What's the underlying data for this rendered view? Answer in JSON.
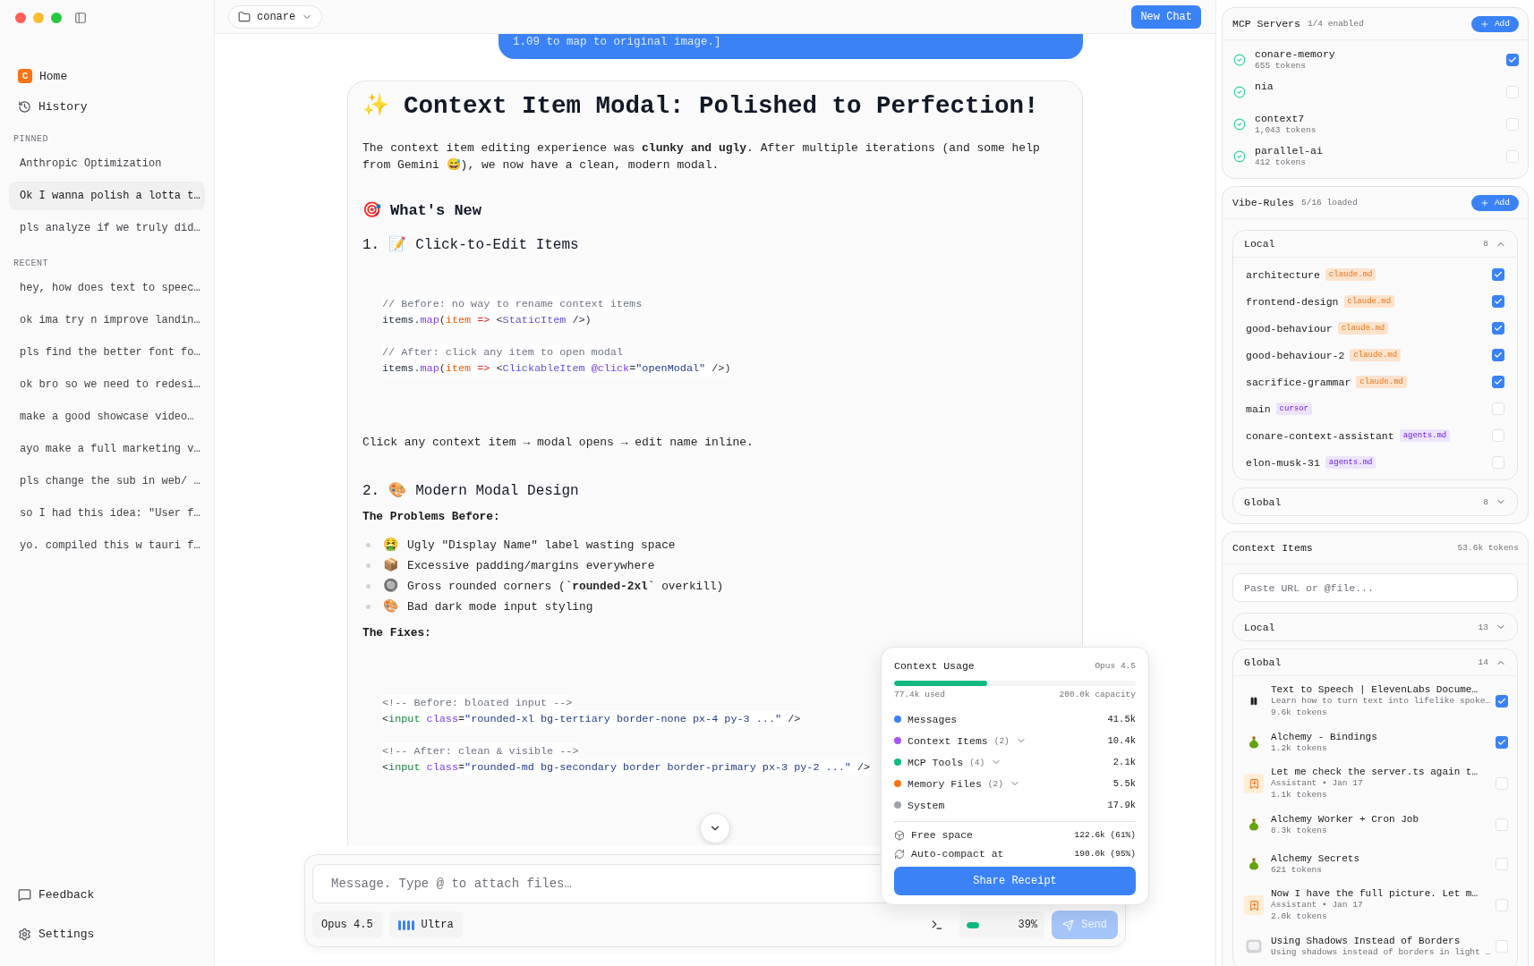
{
  "sidebar": {
    "nav": [
      {
        "label": "Home",
        "logo_letter": "C"
      },
      {
        "label": "History"
      }
    ],
    "sections": [
      {
        "heading": "PINNED",
        "items": [
          {
            "label": "Anthropic Optimization",
            "selected": false
          },
          {
            "label": "Ok I wanna polish a lotta t…",
            "selected": true
          },
          {
            "label": "pls analyze if we truly did…",
            "selected": false
          }
        ]
      },
      {
        "heading": "RECENT",
        "items": [
          {
            "label": "hey, how does text to speec…",
            "selected": false
          },
          {
            "label": "ok ima try n improve landin…",
            "selected": false
          },
          {
            "label": "pls find the better font fo…",
            "selected": false
          },
          {
            "label": "ok bro so we need to redesi…",
            "selected": false
          },
          {
            "label": "make a good showcase video…",
            "selected": false
          },
          {
            "label": "ayo make a full marketing v…",
            "selected": false
          },
          {
            "label": "pls change the sub in web/ …",
            "selected": false
          },
          {
            "label": "so I had this idea: \"User f…",
            "selected": false
          },
          {
            "label": "yo. compiled this w tauri f…",
            "selected": false
          }
        ]
      }
    ],
    "footer": [
      {
        "label": "Feedback"
      },
      {
        "label": "Settings"
      }
    ]
  },
  "topbar": {
    "project": "conare",
    "new_chat": "New Chat"
  },
  "conversation": {
    "user_bubble": "1.09 to map to original image.]",
    "reply": {
      "emoji": "✨",
      "title": "Context Item Modal: Polished to Perfection!",
      "blocks": [
        {
          "kind": "paragraph",
          "text": "The context item editing experience was **clunky and ugly**. After multiple iterations (and some help from Gemini 😅), we now have a clean, modern modal."
        },
        {
          "kind": "h2",
          "emoji": "🎯",
          "text": "What's New"
        },
        {
          "kind": "h3",
          "number": "1.",
          "emoji": "📝",
          "text": "Click-to-Edit Items"
        },
        {
          "kind": "code",
          "groups": [
            [
              {
                "tokens": [
                  {
                    "kind": "comment",
                    "text": "// Before: no way to rename context items"
                  }
                ]
              },
              {
                "tokens": [
                  {
                    "kind": "plain",
                    "text": "items."
                  },
                  {
                    "kind": "fn",
                    "text": "map"
                  },
                  {
                    "kind": "plain",
                    "text": "("
                  },
                  {
                    "kind": "param",
                    "text": "item"
                  },
                  {
                    "kind": "op",
                    "text": " =>"
                  },
                  {
                    "kind": "plain",
                    "text": " <"
                  },
                  {
                    "kind": "component",
                    "text": "StaticItem"
                  },
                  {
                    "kind": "plain",
                    "text": " />)"
                  }
                ]
              }
            ],
            [
              {
                "tokens": [
                  {
                    "kind": "comment",
                    "text": "// After: click any item to open modal"
                  }
                ]
              },
              {
                "tokens": [
                  {
                    "kind": "plain",
                    "text": "items."
                  },
                  {
                    "kind": "fn",
                    "text": "map"
                  },
                  {
                    "kind": "plain",
                    "text": "("
                  },
                  {
                    "kind": "param",
                    "text": "item"
                  },
                  {
                    "kind": "op",
                    "text": " =>"
                  },
                  {
                    "kind": "plain",
                    "text": " <"
                  },
                  {
                    "kind": "component",
                    "text": "ClickableItem"
                  },
                  {
                    "kind": "attr",
                    "text": " @click"
                  },
                  {
                    "kind": "plain",
                    "text": "="
                  },
                  {
                    "kind": "str",
                    "text": "\"openModal\""
                  },
                  {
                    "kind": "plain",
                    "text": " />)"
                  }
                ]
              }
            ]
          ]
        },
        {
          "kind": "paragraph",
          "text": "Click any context item → modal opens → edit name inline."
        },
        {
          "kind": "h3",
          "number": "2.",
          "emoji": "🎨",
          "text": "Modern Modal Design"
        },
        {
          "kind": "label",
          "text": "The Problems Before:"
        },
        {
          "kind": "bullets",
          "items": [
            {
              "emoji": "🤮",
              "text": "Ugly \"Display Name\" label wasting space"
            },
            {
              "emoji": "📦",
              "text": "Excessive padding/margins everywhere"
            },
            {
              "emoji": "🔘",
              "text": "Gross rounded corners (**`rounded-2xl`** overkill)"
            },
            {
              "emoji": "🎨",
              "text": "Bad dark mode input styling"
            }
          ]
        },
        {
          "kind": "label",
          "text": "The Fixes:"
        },
        {
          "kind": "code",
          "groups": [
            [
              {
                "tokens": [
                  {
                    "kind": "comment",
                    "text": "<!-- Before: bloated input -->"
                  }
                ]
              },
              {
                "tokens": [
                  {
                    "kind": "plain",
                    "text": "<"
                  },
                  {
                    "kind": "tag",
                    "text": "input"
                  },
                  {
                    "kind": "attr",
                    "text": " class"
                  },
                  {
                    "kind": "plain",
                    "text": "="
                  },
                  {
                    "kind": "str",
                    "text": "\"rounded-xl bg-tertiary border-none px-4 py-3 ...\""
                  },
                  {
                    "kind": "plain",
                    "text": " />"
                  }
                ]
              }
            ],
            [
              {
                "tokens": [
                  {
                    "kind": "comment",
                    "text": "<!-- After: clean & visible -->"
                  }
                ]
              },
              {
                "tokens": [
                  {
                    "kind": "plain",
                    "text": "<"
                  },
                  {
                    "kind": "tag",
                    "text": "input"
                  },
                  {
                    "kind": "attr",
                    "text": " class"
                  },
                  {
                    "kind": "plain",
                    "text": "="
                  },
                  {
                    "kind": "str",
                    "text": "\"rounded-md bg-secondary border border-primary px-3 py-2 ...\""
                  },
                  {
                    "kind": "plain",
                    "text": " />"
                  }
                ]
              }
            ]
          ]
        }
      ]
    }
  },
  "composer": {
    "placeholder": "Message. Type @ to attach files…",
    "model": "Opus 4.5",
    "effort": "Ultra",
    "meter": {
      "level": 0.39,
      "reading": "39%"
    },
    "send": "Send",
    "send_disabled": true
  },
  "popover": {
    "title": "Context Usage",
    "model": "Opus 4.5",
    "level": 0.387,
    "used": "77.4k used",
    "capacity": "200.0k capacity",
    "rows": [
      {
        "label": "Messages",
        "color": "#3b82f6",
        "value": "41.5k",
        "expandable": false
      },
      {
        "label": "Context Items",
        "count": "(2)",
        "color": "#a855f7",
        "value": "10.4k",
        "expandable": true
      },
      {
        "label": "MCP Tools",
        "count": "(4)",
        "color": "#10b981",
        "value": "2.1k",
        "expandable": true
      },
      {
        "label": "Memory Files",
        "count": "(2)",
        "color": "#f97316",
        "value": "5.5k",
        "expandable": true
      },
      {
        "label": "System",
        "color": "#9ca3af",
        "value": "17.9k",
        "expandable": false
      }
    ],
    "extras": [
      {
        "label": "Free space",
        "value": "122.6k (61%)"
      },
      {
        "label": "Auto-compact at",
        "value": "190.0k (95%)"
      }
    ],
    "button": "Share Receipt"
  },
  "mcp": {
    "title": "MCP Servers",
    "status": "1/4 enabled",
    "add": "Add",
    "servers": [
      {
        "name": "conare-memory",
        "tokens": "655 tokens",
        "checked": true
      },
      {
        "name": "nia",
        "checked": false
      },
      {
        "name": "context7",
        "tokens": "1,043 tokens",
        "checked": false
      },
      {
        "name": "parallel-ai",
        "tokens": "412 tokens",
        "checked": false
      }
    ]
  },
  "vibe_rules": {
    "title": "Vibe-Rules",
    "status": "5/16 loaded",
    "add": "Add",
    "groups": [
      {
        "name": "Local",
        "count": "8",
        "expanded": true,
        "rules": [
          {
            "name": "architecture",
            "tag": "claude.md",
            "color": "#fde2cc",
            "checked": true
          },
          {
            "name": "frontend-design",
            "tag": "claude.md",
            "color": "#fde2cc",
            "checked": true
          },
          {
            "name": "good-behaviour",
            "tag": "claude.md",
            "color": "#fde2cc",
            "checked": true
          },
          {
            "name": "good-behaviour-2",
            "tag": "claude.md",
            "color": "#fde2cc",
            "checked": true
          },
          {
            "name": "sacrifice-grammar",
            "tag": "claude.md",
            "color": "#fde2cc",
            "checked": true
          },
          {
            "name": "main",
            "tag": "cursor",
            "color": "#ede4fb",
            "checked": false
          },
          {
            "name": "conare-context-assistant",
            "tag": "agents.md",
            "color": "#ede4fb",
            "checked": false
          },
          {
            "name": "elon-musk-31",
            "tag": "agents.md",
            "color": "#ede4fb",
            "checked": false
          }
        ]
      },
      {
        "name": "Global",
        "count": "8",
        "expanded": false
      }
    ]
  },
  "context_items": {
    "title": "Context Items",
    "total": "53.6k tokens",
    "placeholder": "Paste URL or @file...",
    "groups": [
      {
        "name": "Local",
        "count": "13",
        "expanded": false
      },
      {
        "name": "Global",
        "count": "14",
        "expanded": true,
        "items": [
          {
            "kind": "pause",
            "title": "Text to Speech | ElevenLabs Docume…",
            "subtitle": "Learn how to turn text into lifelike spoke…",
            "tokens": "9.6k tokens",
            "checked": true
          },
          {
            "kind": "flask",
            "title": "Alchemy - Bindings",
            "tokens": "1.2k tokens",
            "checked": true
          },
          {
            "kind": "bookmark",
            "title": "Let me check the server.ts again t…",
            "subtitle": "Assistant • Jan 17",
            "tokens": "1.1k tokens",
            "checked": false
          },
          {
            "kind": "flask",
            "title": "Alchemy Worker + Cron Job",
            "tokens": "8.3k tokens",
            "checked": false
          },
          {
            "kind": "flask",
            "title": "Alchemy Secrets",
            "tokens": "621 tokens",
            "checked": false
          },
          {
            "kind": "bookmark",
            "title": "Now I have the full picture. Let m…",
            "subtitle": "Assistant • Jan 17",
            "tokens": "2.0k tokens",
            "checked": false
          },
          {
            "kind": "image",
            "title": "Using Shadows Instead of Borders",
            "subtitle": "Using shadows instead of borders in light …",
            "checked": false
          }
        ]
      }
    ]
  }
}
